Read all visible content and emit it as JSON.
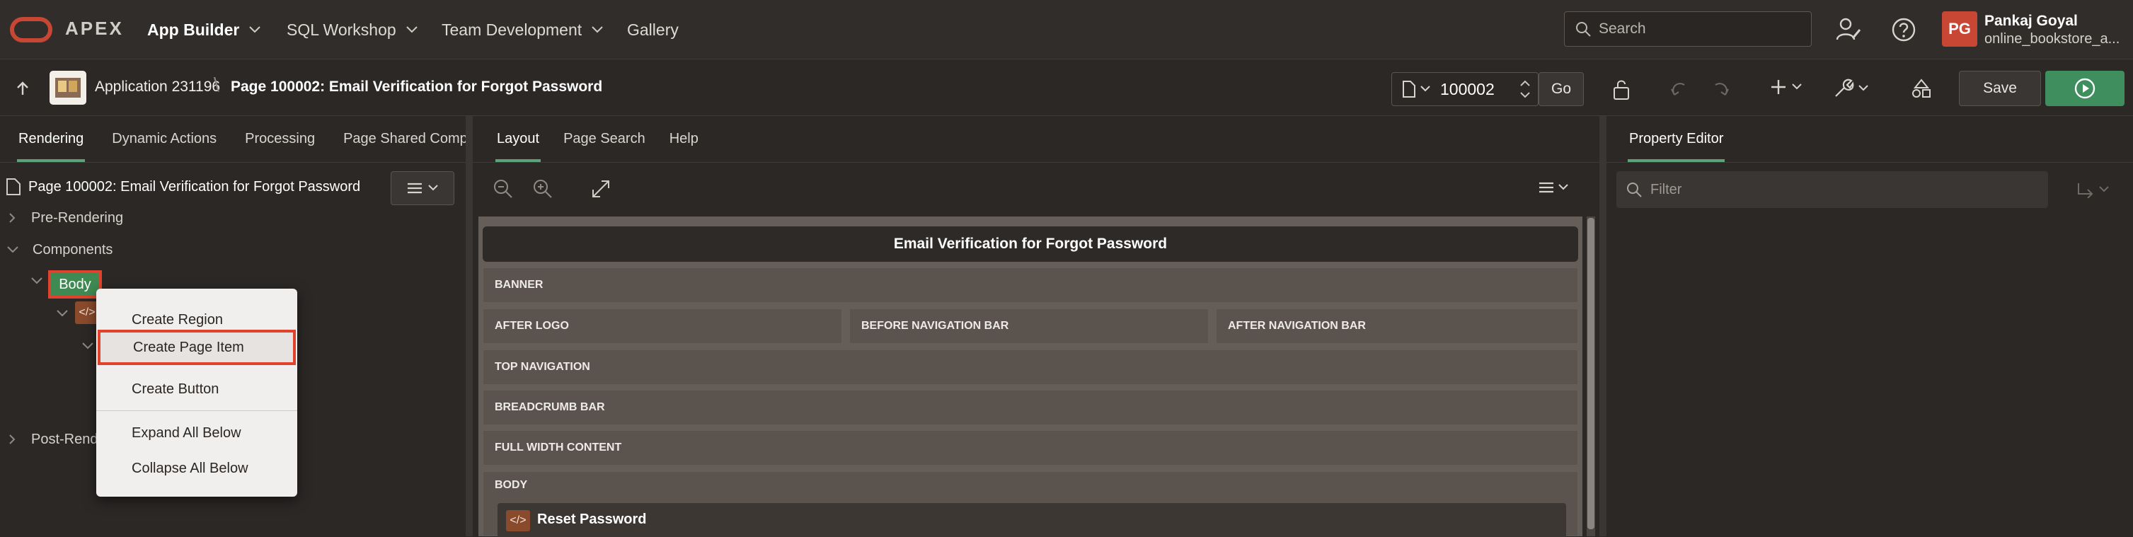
{
  "header": {
    "brand": "APEX",
    "nav": [
      {
        "label": "App Builder"
      },
      {
        "label": "SQL Workshop"
      },
      {
        "label": "Team Development"
      },
      {
        "label": "Gallery"
      }
    ],
    "search_placeholder": "Search",
    "user": {
      "initials": "PG",
      "name": "Pankaj Goyal",
      "workspace": "online_bookstore_a..."
    }
  },
  "toolbar": {
    "application": "Application 231196",
    "page_title": "Page 100002: Email Verification for Forgot Password",
    "page_number": "100002",
    "go_label": "Go",
    "save_label": "Save"
  },
  "left_panel": {
    "tabs": [
      "Rendering",
      "Dynamic Actions",
      "Processing",
      "Page Shared Compor"
    ],
    "root_label": "Page 100002: Email Verification for Forgot Password",
    "tree": {
      "pre_rendering": "Pre-Rendering",
      "components": "Components",
      "body": "Body",
      "post_rendering": "Post-Rend"
    }
  },
  "context_menu": {
    "items": [
      "Create Region",
      "Create Page Item",
      "Create Button",
      "Expand All Below",
      "Collapse All Below"
    ]
  },
  "center_panel": {
    "tabs": [
      "Layout",
      "Page Search",
      "Help"
    ],
    "layout_title": "Email Verification for Forgot Password",
    "regions": {
      "banner": "BANNER",
      "after_logo": "AFTER LOGO",
      "before_nav": "BEFORE NAVIGATION BAR",
      "after_nav": "AFTER NAVIGATION BAR",
      "top_navigation": "TOP NAVIGATION",
      "breadcrumb_bar": "BREADCRUMB BAR",
      "full_width": "FULL WIDTH CONTENT",
      "body": "BODY"
    },
    "region_card": "Reset Password"
  },
  "right_panel": {
    "tab": "Property Editor",
    "filter_placeholder": "Filter"
  },
  "colors": {
    "accent_green": "#5ea279",
    "brand_red": "#c74634",
    "highlight_red": "#e0432d",
    "run_button": "#3e8e5e"
  }
}
